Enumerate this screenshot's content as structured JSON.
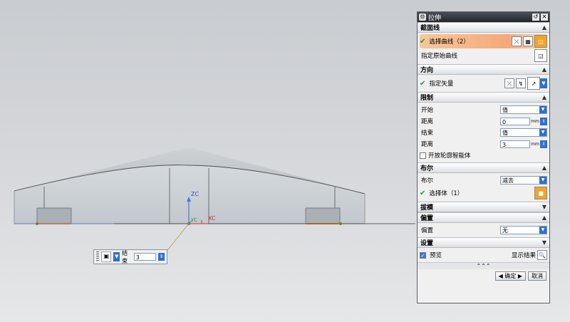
{
  "viewport": {
    "axis_zc": "ZC",
    "axis_yc": "YC",
    "axis_xc": "XC"
  },
  "mini_toolbar": {
    "label": "结束",
    "value": "3"
  },
  "dialog": {
    "title": "拉伸",
    "sections": {
      "section_curve": {
        "title": "截面线",
        "select_curve": "选择曲线（2）",
        "specify_origin_curve": "指定原始曲线"
      },
      "direction": {
        "title": "方向",
        "specify_vector": "指定矢量"
      },
      "limits": {
        "title": "限制",
        "start_label": "开始",
        "start_option": "值",
        "start_distance_label": "距离",
        "start_distance": "0",
        "end_label": "结束",
        "end_option": "值",
        "end_distance_label": "距离",
        "end_distance": "3",
        "unit": "mm",
        "open_profile_label": "开放轮廓智能体"
      },
      "boolean": {
        "title": "布尔",
        "boolean_label": "布尔",
        "boolean_option": "减去",
        "select_body": "选择体（1）"
      },
      "draft": {
        "title": "拔模"
      },
      "offset": {
        "title": "偏置",
        "offset_label": "偏置",
        "offset_option": "无"
      },
      "settings": {
        "title": "设置"
      }
    },
    "preview_label": "预览",
    "show_result_label": "显示结果",
    "ok_label": "确定",
    "cancel_label": "取消"
  }
}
